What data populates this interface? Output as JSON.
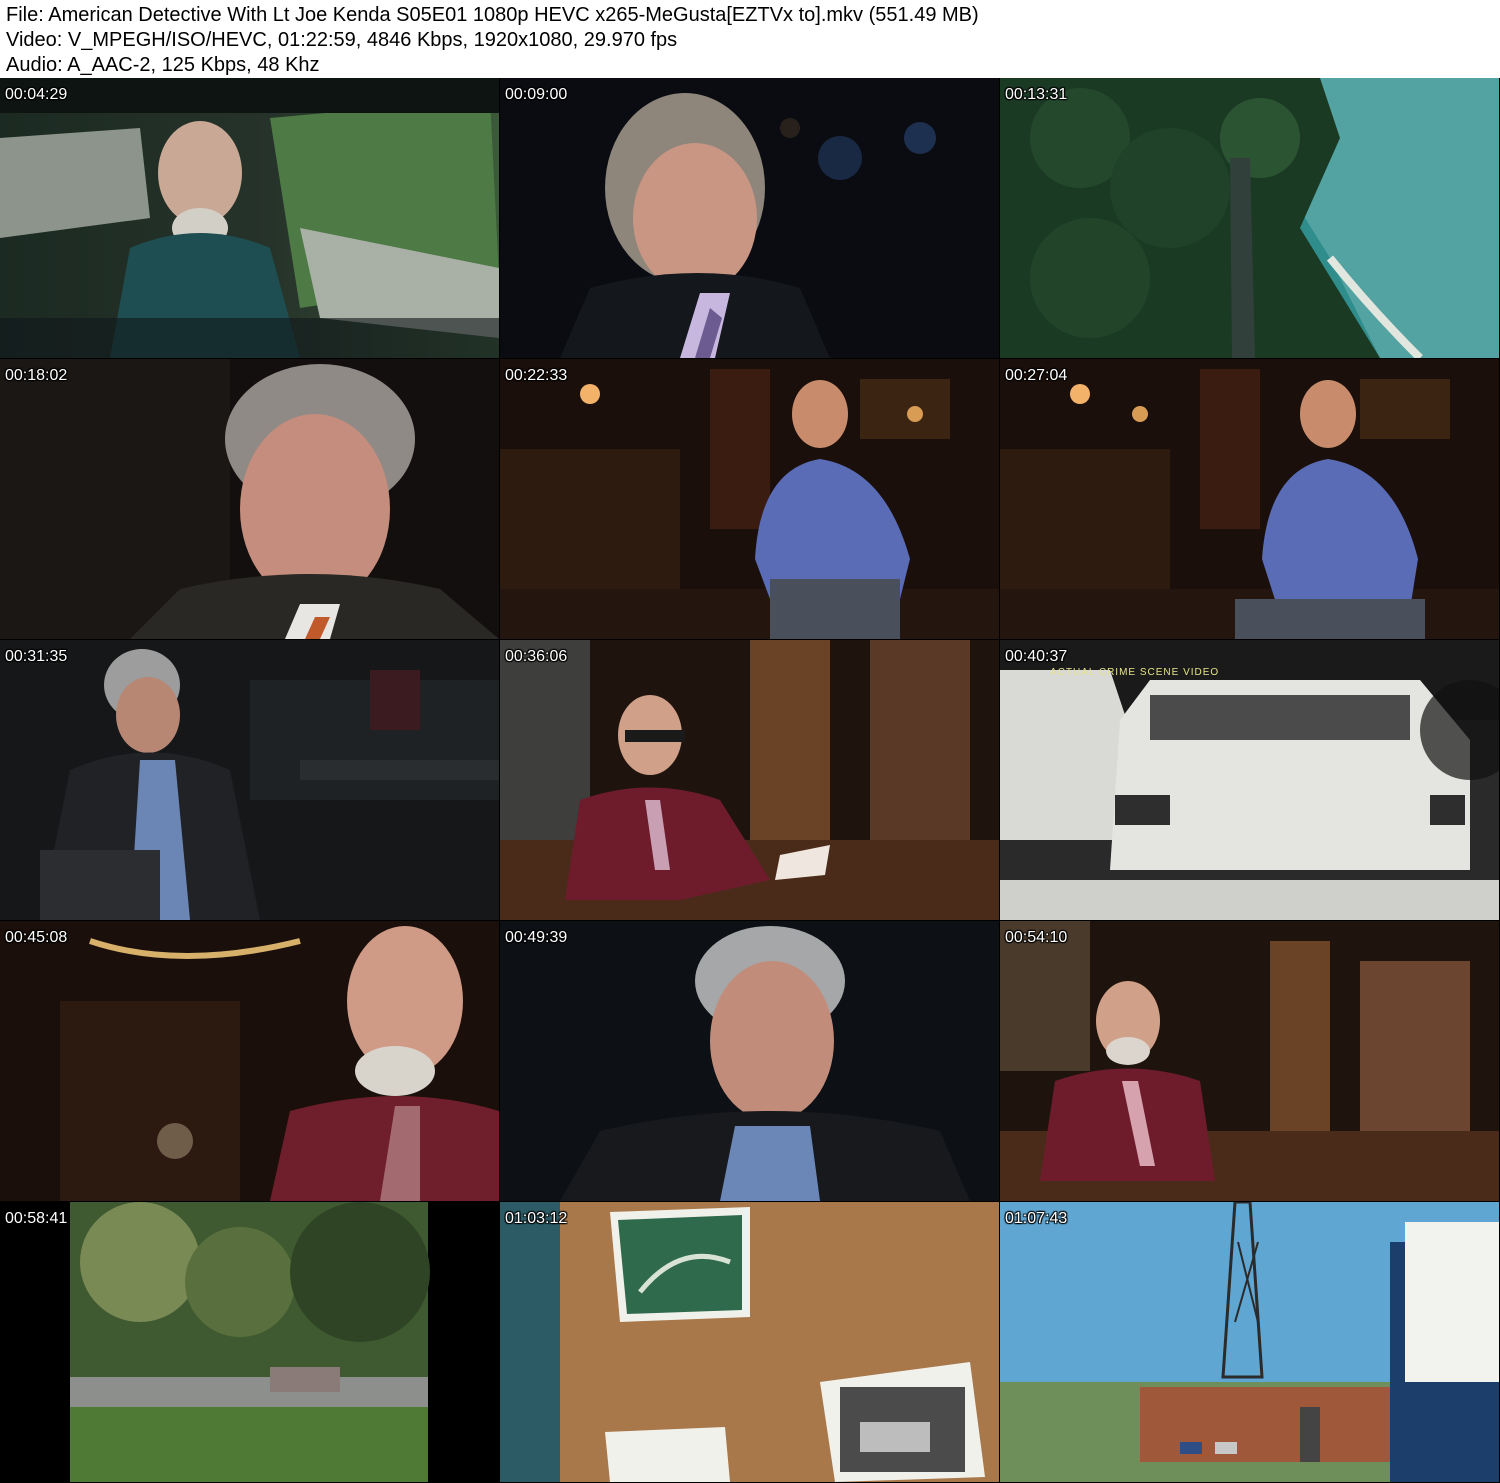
{
  "header": {
    "file_line": "File: American Detective With Lt Joe Kenda S05E01 1080p HEVC x265-MeGusta[EZTVx to].mkv (551.49 MB)",
    "video_line": "Video: V_MPEGH/ISO/HEVC, 01:22:59, 4846 Kbps, 1920x1080, 29.970 fps",
    "audio_line": "Audio: A_AAC-2, 125 Kbps, 48 Khz"
  },
  "thumbnails": [
    {
      "timestamp": "00:04:29",
      "scene": "man-driving-car"
    },
    {
      "timestamp": "00:09:00",
      "scene": "interview-man-suit"
    },
    {
      "timestamp": "00:13:31",
      "scene": "aerial-forest-lake"
    },
    {
      "timestamp": "00:18:02",
      "scene": "interview-grey-hair-man"
    },
    {
      "timestamp": "00:22:33",
      "scene": "man-blue-shirt-seated"
    },
    {
      "timestamp": "00:27:04",
      "scene": "man-blue-shirt-seated"
    },
    {
      "timestamp": "00:31:35",
      "scene": "older-man-dark-room"
    },
    {
      "timestamp": "00:36:06",
      "scene": "man-reading-at-desk"
    },
    {
      "timestamp": "00:40:37",
      "scene": "crime-scene-white-car",
      "caption": "ACTUAL CRIME SCENE VIDEO"
    },
    {
      "timestamp": "00:45:08",
      "scene": "man-red-shirt-closeup"
    },
    {
      "timestamp": "00:49:39",
      "scene": "older-man-interview"
    },
    {
      "timestamp": "00:54:10",
      "scene": "man-red-shirt-at-desk"
    },
    {
      "timestamp": "00:58:41",
      "scene": "roadside-trees"
    },
    {
      "timestamp": "01:03:12",
      "scene": "corkboard-photos"
    },
    {
      "timestamp": "01:07:43",
      "scene": "state-police-building-sign"
    }
  ]
}
